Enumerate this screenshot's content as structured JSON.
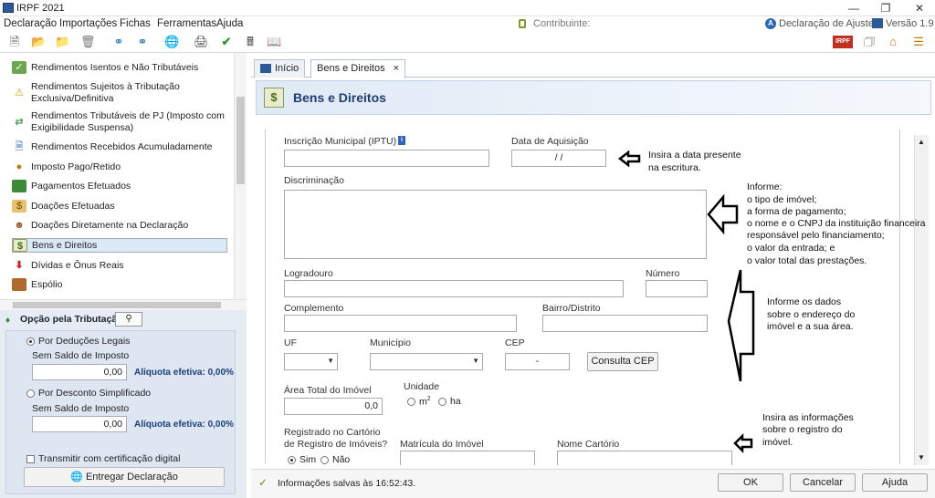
{
  "window": {
    "title": "IRPF 2021"
  },
  "menu": [
    {
      "label": "Declaração"
    },
    {
      "label": "Importações"
    },
    {
      "label": "Fichas"
    },
    {
      "label": "Ferramentas"
    },
    {
      "label": "Ajuda"
    }
  ],
  "header_right": {
    "contribuinte": "Contribuinte:",
    "declaracao": "Declaração de Ajuste",
    "versao": "Versão 1.9"
  },
  "nav": {
    "items": [
      {
        "label": "Rendimentos Isentos e Não Tributáveis"
      },
      {
        "label": "Rendimentos Sujeitos à Tributação Exclusiva/Definitiva"
      },
      {
        "label": "Rendimentos Tributáveis de PJ (Imposto com Exigibilidade Suspensa)"
      },
      {
        "label": "Rendimentos Recebidos Acumuladamente"
      },
      {
        "label": "Imposto Pago/Retido"
      },
      {
        "label": "Pagamentos Efetuados"
      },
      {
        "label": "Doações Efetuadas"
      },
      {
        "label": "Doações Diretamente na Declaração"
      },
      {
        "label": "Bens e Direitos"
      },
      {
        "label": "Dívidas e Ônus Reais"
      },
      {
        "label": "Espólio"
      }
    ]
  },
  "opcao": {
    "title": "Opção pela Tributação:",
    "deducoes_label": "Por Deduções Legais",
    "deducoes_sub": "Sem Saldo de Imposto",
    "deducoes_value": "0,00",
    "deducoes_aliq": "Alíquota efetiva: 0,00%",
    "simplificado_label": "Por Desconto Simplificado",
    "simplificado_sub": "Sem Saldo de Imposto",
    "simplificado_value": "0,00",
    "simplificado_aliq": "Alíquota efetiva: 0,00%",
    "certificado_label": "Transmitir com certificação digital",
    "entregar_label": "Entregar Declaração"
  },
  "tabs": [
    {
      "label": "Início"
    },
    {
      "label": "Bens e Direitos"
    }
  ],
  "tab_close": "×",
  "page": {
    "title": "Bens e Direitos"
  },
  "form": {
    "iptu_label": "Inscrição Municipal (IPTU)",
    "data_label": "Data de Aquisição",
    "data_value": "/ /",
    "discriminacao_label": "Discriminação",
    "logradouro_label": "Logradouro",
    "numero_label": "Número",
    "complemento_label": "Complemento",
    "bairro_label": "Bairro/Distrito",
    "uf_label": "UF",
    "municipio_label": "Município",
    "cep_label": "CEP",
    "cep_value": "-",
    "consulta_cep": "Consulta CEP",
    "area_label": "Área Total do Imóvel",
    "area_value": "0,0",
    "unidade_label": "Unidade",
    "unit_m2": "m",
    "unit_m2_sup": "2",
    "unit_ha": "ha",
    "registro_label_1": "Registrado no Cartório",
    "registro_label_2": "de Registro de Imóveis?",
    "sim": "Sim",
    "nao": "Não",
    "matricula_label": "Matrícula do Imóvel",
    "cartorio_label": "Nome Cartório"
  },
  "notes": {
    "data_note_1": "Insira a data presente",
    "data_note_2": "na escritura.",
    "informe": [
      "Informe:",
      "o tipo de imóvel;",
      "a forma de pagamento;",
      "o nome e o CNPJ da instituição financeira",
      "responsável pelo financiamento;",
      "o valor da entrada; e",
      "o valor total das prestações."
    ],
    "endereco": [
      "Informe os dados",
      "sobre o endereço do",
      "imóvel e a sua área."
    ],
    "registro": [
      "Insira as informações",
      "sobre o registro do",
      "imóvel."
    ]
  },
  "status": {
    "message": "Informações salvas às 16:52:43.",
    "ok": "OK",
    "cancelar": "Cancelar",
    "ajuda": "Ajuda"
  }
}
